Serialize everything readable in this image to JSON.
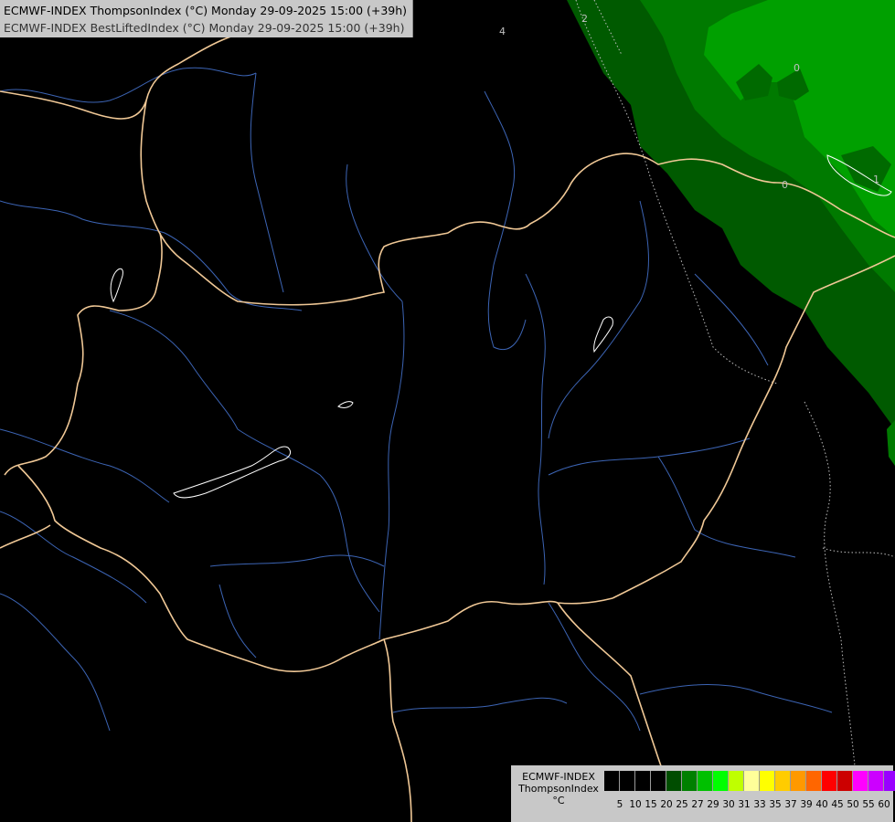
{
  "title": {
    "line1": "ECMWF-INDEX ThompsonIndex (°C) Monday 29-09-2025 15:00 (+39h)",
    "line2": "ECMWF-INDEX BestLiftedIndex (°C) Monday 29-09-2025 15:00 (+39h)"
  },
  "legend": {
    "source": "ECMWF-INDEX",
    "variable": "ThompsonIndex",
    "unit": "°C",
    "colors": [
      "#000000",
      "#000000",
      "#000000",
      "#000000",
      "#004d00",
      "#008000",
      "#00c000",
      "#00ff00",
      "#bfff00",
      "#ffff99",
      "#ffff00",
      "#ffcc00",
      "#ff9900",
      "#ff6600",
      "#ff0000",
      "#cc0000",
      "#ff00ff",
      "#cc00ff",
      "#9900ff",
      "#6600ff",
      "#0000ff"
    ],
    "ticks": [
      "5",
      "10",
      "15",
      "20",
      "25",
      "27",
      "29",
      "30",
      "31",
      "33",
      "35",
      "37",
      "39",
      "40",
      "45",
      "50",
      "55",
      "60"
    ]
  },
  "map": {
    "colors": {
      "background": "#000000",
      "border": "#f0c896",
      "river": "#3c64b4",
      "lake": "#ffffff",
      "isoline": "#bfbfbf",
      "field_dark": "#005a00",
      "field_mid": "#007a00",
      "field_light": "#00a000"
    },
    "contour_labels": [
      "2",
      "4",
      "0",
      "1",
      "0"
    ]
  }
}
